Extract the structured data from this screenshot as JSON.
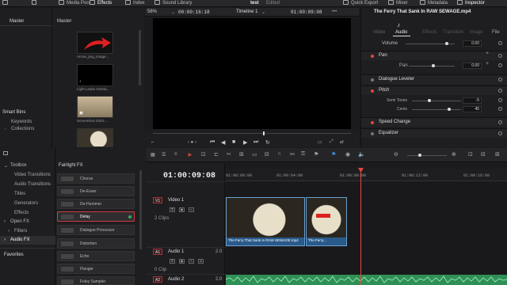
{
  "topbar": {
    "media_pool": "Media Pool",
    "effects": "Effects",
    "index": "Index",
    "sound_library": "Sound Library",
    "project": "test",
    "edited": "Edited",
    "quick_export": "Quick Export",
    "mixer": "Mixer",
    "metadata": "Metadata",
    "inspector": "Inspector"
  },
  "media_pool": {
    "bin_header": "Master",
    "clips_header": "Master",
    "smart_bins": "Smart Bins",
    "keywords": "Keywords",
    "collections": "Collections",
    "thumbs": [
      {
        "caption": "Arrow_png_image..."
      },
      {
        "caption": "Light Leaks Overla..."
      },
      {
        "caption": "Screenshot 2024-..."
      },
      {
        "caption": ""
      }
    ]
  },
  "viewer": {
    "zoom": "58%",
    "timecode_left": "00:00:16:18",
    "timeline_name": "Timeline 1",
    "timecode_right": "01:00:09:08"
  },
  "inspector": {
    "clip_title": "The Ferry That Sank In RAW SEWAGE.mp4",
    "tabs": [
      "Video",
      "Audio",
      "Effects",
      "Transition",
      "Image",
      "File"
    ],
    "active_tab": "Audio",
    "volume_label": "Volume",
    "volume_value": "0.00",
    "pan_label": "Pan",
    "pan_sub_label": "Pan",
    "pan_value": "0.00",
    "dialogue_leveler": "Dialogue Leveler",
    "pitch": "Pitch",
    "semi_tones": "Semi Tones",
    "semi_tones_value": "-5",
    "cents": "Cents",
    "cents_value": "45",
    "speed_change": "Speed Change",
    "equalizer": "Equalizer"
  },
  "effects_library": {
    "toolbox": "Toolbox",
    "video_transitions": "Video Transitions",
    "audio_transitions": "Audio Transitions",
    "titles": "Titles",
    "generators": "Generators",
    "effects": "Effects",
    "open_fx": "Open FX",
    "filters": "Filters",
    "audio_fx": "Audio FX",
    "favorites": "Favorites",
    "list_header": "Fairlight FX",
    "items": [
      "Chorus",
      "De-Esser",
      "De-Hummer",
      "Delay",
      "Dialogue Processor",
      "Distortion",
      "Echo",
      "Flanger",
      "Foley Sampler"
    ],
    "selected": "Delay"
  },
  "timeline": {
    "timecode": "01:00:09:08",
    "ruler": [
      "01:00:00:00",
      "01:00:04:00",
      "01:00:08:00",
      "01:00:12:00",
      "01:00:16:00"
    ],
    "video1_tag": "V1",
    "video1_name": "Video 1",
    "video1_clips": "2 Clips",
    "audio1_tag": "A1",
    "audio1_name": "Audio 1",
    "audio1_level": "2.0",
    "audio1_clips": "0 Clip",
    "audio2_tag": "A2",
    "audio2_name": "Audio 2",
    "audio2_level": "2.0",
    "clip1_name": "The Ferry That Sank In RAW SEWAGE.mp4",
    "clip2_name": "The Ferry..."
  },
  "colors": {
    "accent_red": "#e5473c",
    "video_clip": "#2a5a8a",
    "audio_clip": "#2f8f55"
  }
}
